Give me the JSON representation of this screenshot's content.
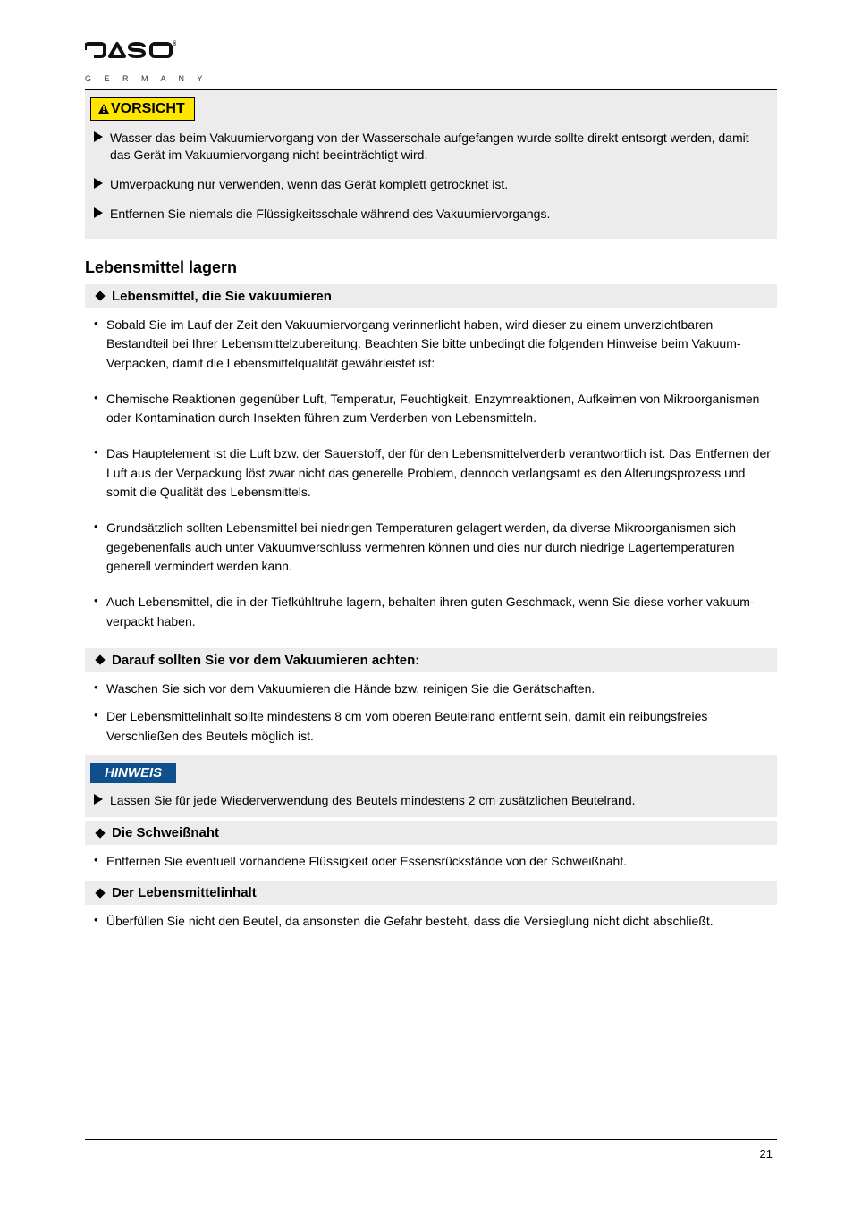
{
  "logo": {
    "top": "CASO",
    "sub": "G E R M A N Y",
    "reg": "®"
  },
  "vorsicht_badge": "VORSICHT",
  "vorsicht_items": [
    "Wasser das beim Vakuumiervorgang von der Wasserschale aufgefangen wurde sollte direkt entsorgt werden, damit das Gerät im Vakuumiervorgang nicht beeinträchtigt wird.",
    "Umverpackung nur verwenden, wenn das Gerät komplett getrocknet ist.",
    "Entfernen Sie niemals die Flüssigkeitsschale während des Vakuumiervorgangs."
  ],
  "section_title": "Lebensmittel lagern",
  "sec1": {
    "heading": "Lebensmittel, die Sie vakuumieren",
    "items": [
      "Sobald Sie im Lauf der Zeit den Vakuumiervorgang verinnerlicht haben, wird dieser zu einem unverzichtbaren Bestandteil bei Ihrer Lebensmittelzubereitung. Beachten Sie bitte unbedingt die folgenden Hinweise beim Vakuum-Verpacken, damit die Lebensmittelqualität gewährleistet ist:",
      "Chemische Reaktionen gegenüber Luft, Temperatur, Feuchtigkeit, Enzymreaktionen, Aufkeimen von Mikroorganismen oder Kontamination durch Insekten führen zum Verderben von Lebensmitteln.",
      "Das Hauptelement ist die Luft bzw. der Sauerstoff, der für den Lebensmittelverderb verantwortlich ist. Das Entfernen der Luft aus der Verpackung löst zwar nicht das generelle Problem, dennoch verlangsamt es den Alterungsprozess und somit die Qualität des Lebensmittels.",
      "Grundsätzlich sollten Lebensmittel bei niedrigen Temperaturen gelagert werden, da diverse Mikroorganismen sich gegebenenfalls auch unter Vakuumverschluss vermehren können und dies nur durch niedrige Lagertemperaturen generell vermindert werden kann.",
      "Auch Lebensmittel, die in der Tiefkühltruhe lagern, behalten ihren guten Geschmack, wenn Sie diese vorher vakuum-verpackt haben."
    ]
  },
  "sec2": {
    "heading": "Darauf sollten Sie vor dem Vakuumieren achten:",
    "items": [
      "Waschen Sie sich vor dem Vakuumieren die Hände bzw. reinigen Sie die Gerätschaften.",
      "Der Lebensmittelinhalt sollte mindestens 8 cm vom oberen Beutelrand entfernt sein, damit ein reibungsfreies Verschließen des Beutels möglich ist."
    ]
  },
  "hinweis_badge": "HINWEIS",
  "hinweis_items": [
    "Lassen Sie für jede Wiederverwendung des Beutels mindestens 2 cm zusätzlichen Beutelrand."
  ],
  "sec3": {
    "heading": "Die Schweißnaht",
    "items": [
      "Entfernen Sie eventuell vorhandene Flüssigkeit oder Essensrückstände von der Schweißnaht."
    ]
  },
  "sec4": {
    "heading": "Der Lebensmittelinhalt",
    "items": [
      "Überfüllen Sie nicht den Beutel, da ansonsten die Gefahr besteht, dass die Versieglung nicht dicht abschließt."
    ]
  },
  "page_number": "21"
}
